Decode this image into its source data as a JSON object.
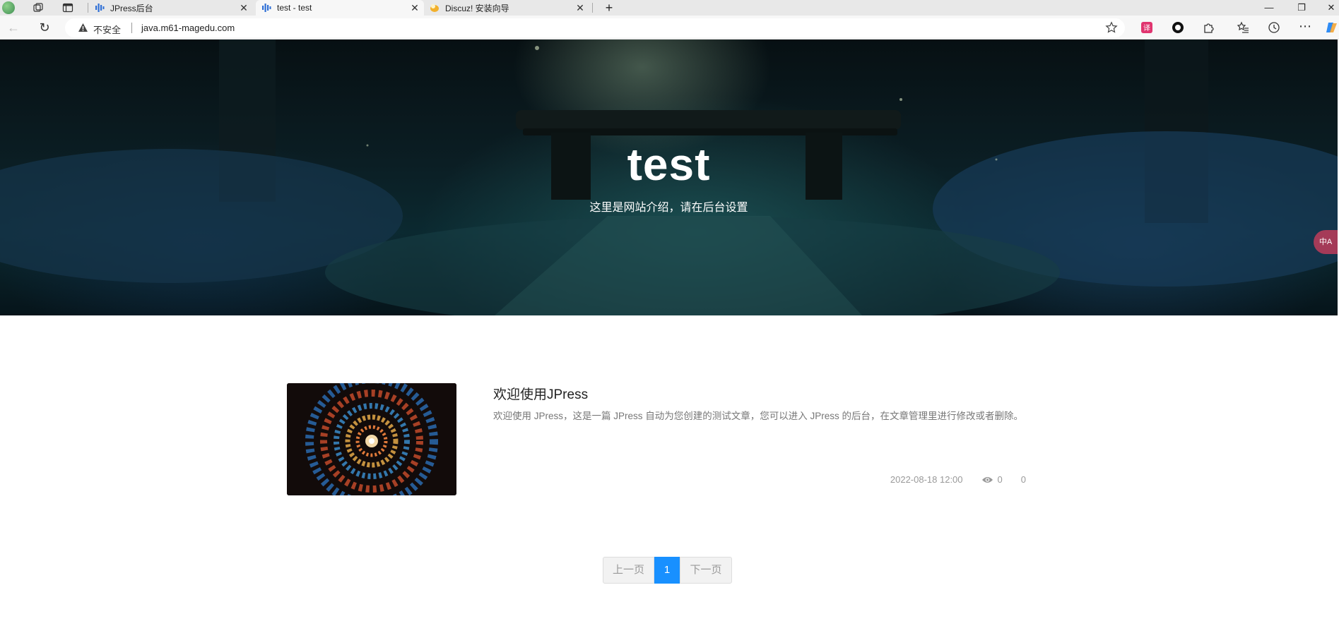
{
  "browser": {
    "tabs": [
      {
        "title": "JPress后台",
        "active": false
      },
      {
        "title": "test - test",
        "active": true
      },
      {
        "title": "Discuz! 安装向导",
        "active": false
      }
    ],
    "insecure_label": "不安全",
    "url": "java.m61-magedu.com",
    "icons": [
      "profile-icon",
      "workspaces-icon",
      "tab-actions-icon",
      "new-tab-icon",
      "minimize-icon",
      "restore-icon",
      "close-window-icon",
      "back-icon",
      "refresh-icon",
      "warning-icon",
      "favorite-star-icon",
      "extension-icon",
      "collections-icon",
      "history-icon",
      "more-icon",
      "copilot-icon"
    ]
  },
  "hero": {
    "title": "test",
    "subtitle": "这里是网站介绍，请在后台设置",
    "translate_fab": "中A"
  },
  "posts": [
    {
      "title": "欢迎使用JPress",
      "excerpt": "欢迎使用 JPress，这是一篇 JPress 自动为您创建的测试文章，您可以进入 JPress 的后台，在文章管理里进行修改或者删除。",
      "date": "2022-08-18 12:00",
      "views": "0",
      "comments": "0"
    }
  ],
  "pagination": {
    "prev": "上一页",
    "current": "1",
    "next": "下一页"
  },
  "colors": {
    "accent": "#1890ff",
    "hero_dark": "#0b1e24"
  }
}
